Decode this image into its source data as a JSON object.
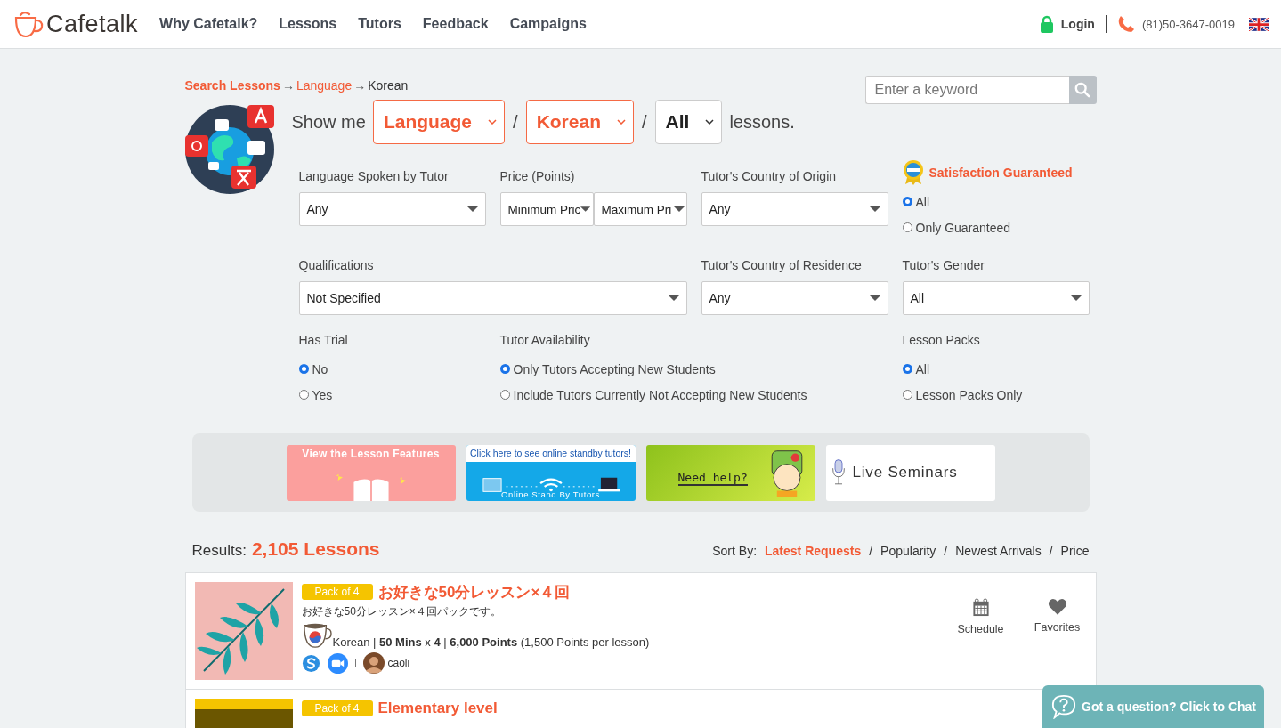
{
  "header": {
    "logo": "Cafetalk",
    "nav": [
      "Why Cafetalk?",
      "Lessons",
      "Tutors",
      "Feedback",
      "Campaigns"
    ],
    "login": "Login",
    "phone": "(81)50-3647-0019"
  },
  "breadcrumb": [
    {
      "text": "Search Lessons",
      "kind": "root"
    },
    {
      "text": "→",
      "kind": "sep"
    },
    {
      "text": "Language",
      "kind": "link"
    },
    {
      "text": "→",
      "kind": "sep"
    },
    {
      "text": "Korean",
      "kind": "current"
    }
  ],
  "search": {
    "placeholder": "Enter a keyword"
  },
  "show_me": {
    "prefix": "Show me",
    "suffix": "lessons.",
    "parts": [
      {
        "kind": "select",
        "value": "Language",
        "active": true
      },
      {
        "kind": "sep",
        "text": "/"
      },
      {
        "kind": "select",
        "value": "Korean",
        "active": true
      },
      {
        "kind": "sep",
        "text": "/"
      },
      {
        "kind": "select",
        "value": "All",
        "active": false
      }
    ]
  },
  "filter_rows": [
    [
      {
        "kind": "select",
        "label": "Language Spoken by Tutor",
        "values": [
          "Any"
        ]
      },
      {
        "kind": "select",
        "label": "Price (Points)",
        "values": [
          "Minimum Pric",
          "Maximum Pri"
        ]
      },
      {
        "kind": "select",
        "label": "Tutor's Country of Origin",
        "values": [
          "Any"
        ]
      },
      {
        "kind": "guarantee",
        "label": "Satisfaction Guaranteed",
        "options": [
          {
            "label": "All",
            "selected": true
          },
          {
            "label": "Only Guaranteed",
            "selected": false
          }
        ]
      }
    ],
    [
      {
        "kind": "select",
        "label": "Qualifications",
        "values": [
          "Not Specified"
        ]
      },
      {
        "kind": "select",
        "label": "Tutor's Country of Residence",
        "values": [
          "Any"
        ]
      },
      {
        "kind": "select",
        "label": "Tutor's Gender",
        "values": [
          "All"
        ]
      }
    ],
    [
      {
        "kind": "radio",
        "label": "Has Trial",
        "options": [
          {
            "label": "No",
            "selected": true
          },
          {
            "label": "Yes",
            "selected": false
          }
        ]
      },
      {
        "kind": "radio",
        "label": "Tutor Availability",
        "options": [
          {
            "label": "Only Tutors Accepting New Students",
            "selected": true
          },
          {
            "label": "Include Tutors Currently Not Accepting New Students",
            "selected": false
          }
        ]
      },
      {
        "kind": "radio",
        "label": "Lesson Packs",
        "options": [
          {
            "label": "All",
            "selected": true
          },
          {
            "label": "Lesson Packs Only",
            "selected": false
          }
        ]
      }
    ]
  ],
  "banners": [
    {
      "kind": "features",
      "text": "View the Lesson Features"
    },
    {
      "kind": "standby",
      "text": "Click here to see online standby tutors!",
      "caption": "Online Stand By Tutors"
    },
    {
      "kind": "help",
      "text": "Need help?"
    },
    {
      "kind": "seminars",
      "text": "Live Seminars"
    }
  ],
  "results": {
    "label": "Results:",
    "count": "2,105 Lessons"
  },
  "sort": {
    "label": "Sort By:",
    "items": [
      {
        "kind": "option",
        "text": "Latest Requests",
        "selected": true
      },
      {
        "kind": "sep",
        "text": "/"
      },
      {
        "kind": "option",
        "text": "Popularity",
        "selected": false
      },
      {
        "kind": "sep",
        "text": "/"
      },
      {
        "kind": "option",
        "text": "Newest Arrivals",
        "selected": false
      },
      {
        "kind": "sep",
        "text": "/"
      },
      {
        "kind": "option",
        "text": "Price",
        "selected": false
      }
    ]
  },
  "lessons": [
    {
      "pack": "Pack of 4",
      "title": "お好きな50分レッスン×４回",
      "description": "お好きな50分レッスン×４回パックです。",
      "details": "Korean | **50 Mins** x **4** | **6,000 Points** (1,500 Points per lesson)",
      "tools": [
        {
          "kind": "skype"
        },
        {
          "kind": "zoom"
        }
      ],
      "tutor": "caoli",
      "actions": [
        {
          "kind": "schedule",
          "label": "Schedule"
        },
        {
          "kind": "favorite",
          "label": "Favorites"
        }
      ]
    },
    {
      "pack": "Pack of 4",
      "title": "Elementary level"
    }
  ],
  "chat": {
    "label": "Got a question? Click to Chat"
  }
}
